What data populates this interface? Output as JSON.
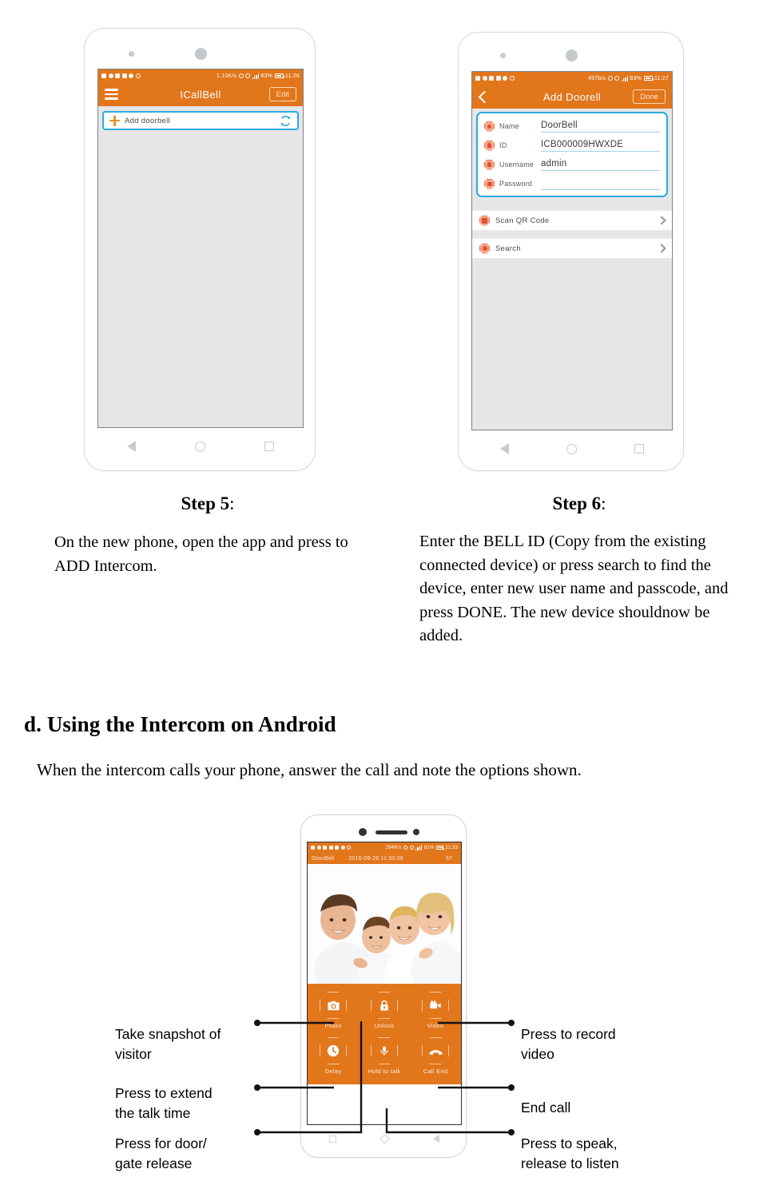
{
  "colors": {
    "orange": "#e2761b",
    "blue_highlight": "#29abe2",
    "screen_gray": "#e6e6e6",
    "text": "#000000"
  },
  "phone1": {
    "statusbar": {
      "speed": "1.10K/s",
      "battery": "83%",
      "time": "11:26"
    },
    "appbar": {
      "title": "ICallBell",
      "menu_icon": "hamburger-icon",
      "edit_label": "Edit"
    },
    "list": {
      "add_label": "Add  doorbell",
      "plus_icon": "plus-icon",
      "refresh_icon": "refresh-icon"
    },
    "nav": {
      "back": "back-icon",
      "home": "home-icon",
      "recents": "recents-icon"
    }
  },
  "phone2": {
    "statusbar": {
      "speed": "497b/s",
      "battery": "83%",
      "time": "11:27"
    },
    "appbar": {
      "title": "Add  Doorell",
      "back_icon": "chevron-left-icon",
      "done_label": "Done"
    },
    "form": [
      {
        "icon": "dot-icon",
        "label": "Name",
        "value": "DoorBell"
      },
      {
        "icon": "bell-icon",
        "label": "ID",
        "value": "ICB000009HWXDE"
      },
      {
        "icon": "user-icon",
        "label": "Username",
        "value": "admin"
      },
      {
        "icon": "lock-icon",
        "label": "Password",
        "value": ""
      }
    ],
    "options": [
      {
        "icon": "qr-icon",
        "label": "Scan  QR  Code"
      },
      {
        "icon": "search-icon",
        "label": "Search"
      }
    ]
  },
  "steps": [
    {
      "title": "Step 5",
      "colon": ":",
      "body": "On the new phone, open the app and press to ADD Intercom."
    },
    {
      "title": "Step 6",
      "colon": ":",
      "body": "Enter the BELL ID (Copy from the existing connected device) or press search to find the device, enter new user name and passcode, and press DONE. The new device shouldnow be added."
    }
  ],
  "section": {
    "heading": "d. Using the Intercom on Android",
    "body": "When the intercom calls your phone, answer the call and note the options shown."
  },
  "phone3": {
    "statusbar": {
      "speed": "294K/s",
      "battery": "81%",
      "time": "11:33"
    },
    "call_header": {
      "device": "DoorBell",
      "timestamp": "2016-09-28 11:33:39",
      "counter": "57"
    },
    "photo_alt": "family-photo",
    "controls": [
      {
        "icon": "camera-icon",
        "label": "Photo"
      },
      {
        "icon": "lock-icon",
        "label": "Unlock"
      },
      {
        "icon": "video-icon",
        "label": "Video"
      },
      {
        "icon": "clock-icon",
        "label": "Delay"
      },
      {
        "icon": "microphone-icon",
        "label": "Hold  to  talk"
      },
      {
        "icon": "phone-down-icon",
        "label": "Call  End"
      }
    ]
  },
  "annotations": {
    "left": [
      "Take snapshot of\nvisitor",
      "Press to extend\nthe talk time",
      "Press for door/\ngate release"
    ],
    "right": [
      "Press to record\nvideo",
      "End call",
      "Press to speak,\nrelease to listen"
    ]
  }
}
